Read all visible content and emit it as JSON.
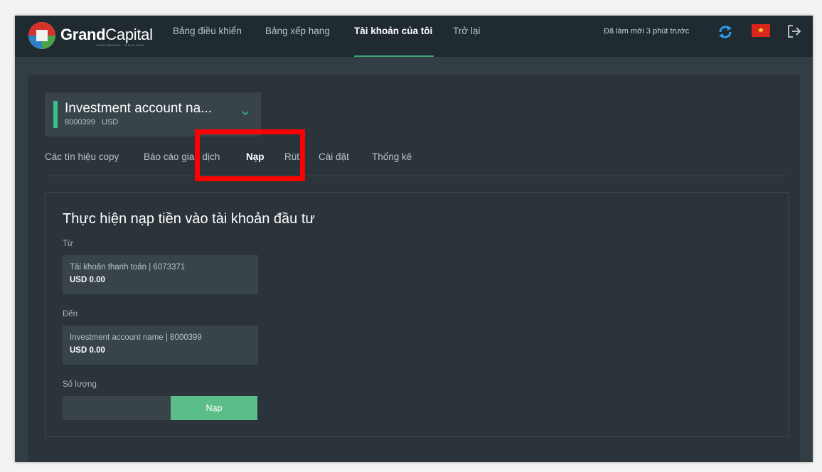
{
  "brand": {
    "name_bold": "Grand",
    "name_regular": "Capital",
    "tagline": "YOUR BROKER · SINCE 2006",
    "logo_colors": [
      "#d6322c",
      "#4aa24a",
      "#2f7fc8",
      "#f2f2f2"
    ]
  },
  "nav": {
    "items": [
      {
        "label": "Bảng điều khiển",
        "active": false
      },
      {
        "label": "Bảng xếp hạng",
        "active": false
      },
      {
        "label": "Tài khoản của tôi",
        "active": true
      },
      {
        "label": "Trở lại",
        "active": false
      }
    ],
    "refresh_status": "Đã làm mới 3 phút trước",
    "refresh_icon": "refresh-icon",
    "flag_icon": "vietnam-flag-icon",
    "logout_icon": "logout-icon"
  },
  "account_selector": {
    "name": "Investment account na...",
    "number": "8000399",
    "currency": "USD",
    "chevron_icon": "chevron-down-icon"
  },
  "tabs": [
    {
      "label": "Các tín hiệu copy",
      "active": false
    },
    {
      "label": "Báo cáo giao dịch",
      "active": false
    },
    {
      "label": "Nạp",
      "active": true
    },
    {
      "label": "Rút",
      "active": false
    },
    {
      "label": "Cài đặt",
      "active": false
    },
    {
      "label": "Thống kê",
      "active": false
    }
  ],
  "deposit_form": {
    "title": "Thực hiện nạp tiền vào tài khoản đầu tư",
    "from_label": "Từ",
    "from_account": {
      "line1": "Tài khoản thanh toán | 6073371",
      "balance": "USD 0.00"
    },
    "to_label": "Đến",
    "to_account": {
      "line1": "Investment account name | 8000399",
      "balance": "USD 0.00"
    },
    "amount_label": "Số lượng",
    "amount_value": "",
    "submit_label": "Nạp"
  },
  "colors": {
    "accent_green": "#5bbd87",
    "account_bar": "#35c28f",
    "highlight_red": "#ff0000",
    "nav_bg": "#1f2a31",
    "content_bg": "#2b343b"
  }
}
